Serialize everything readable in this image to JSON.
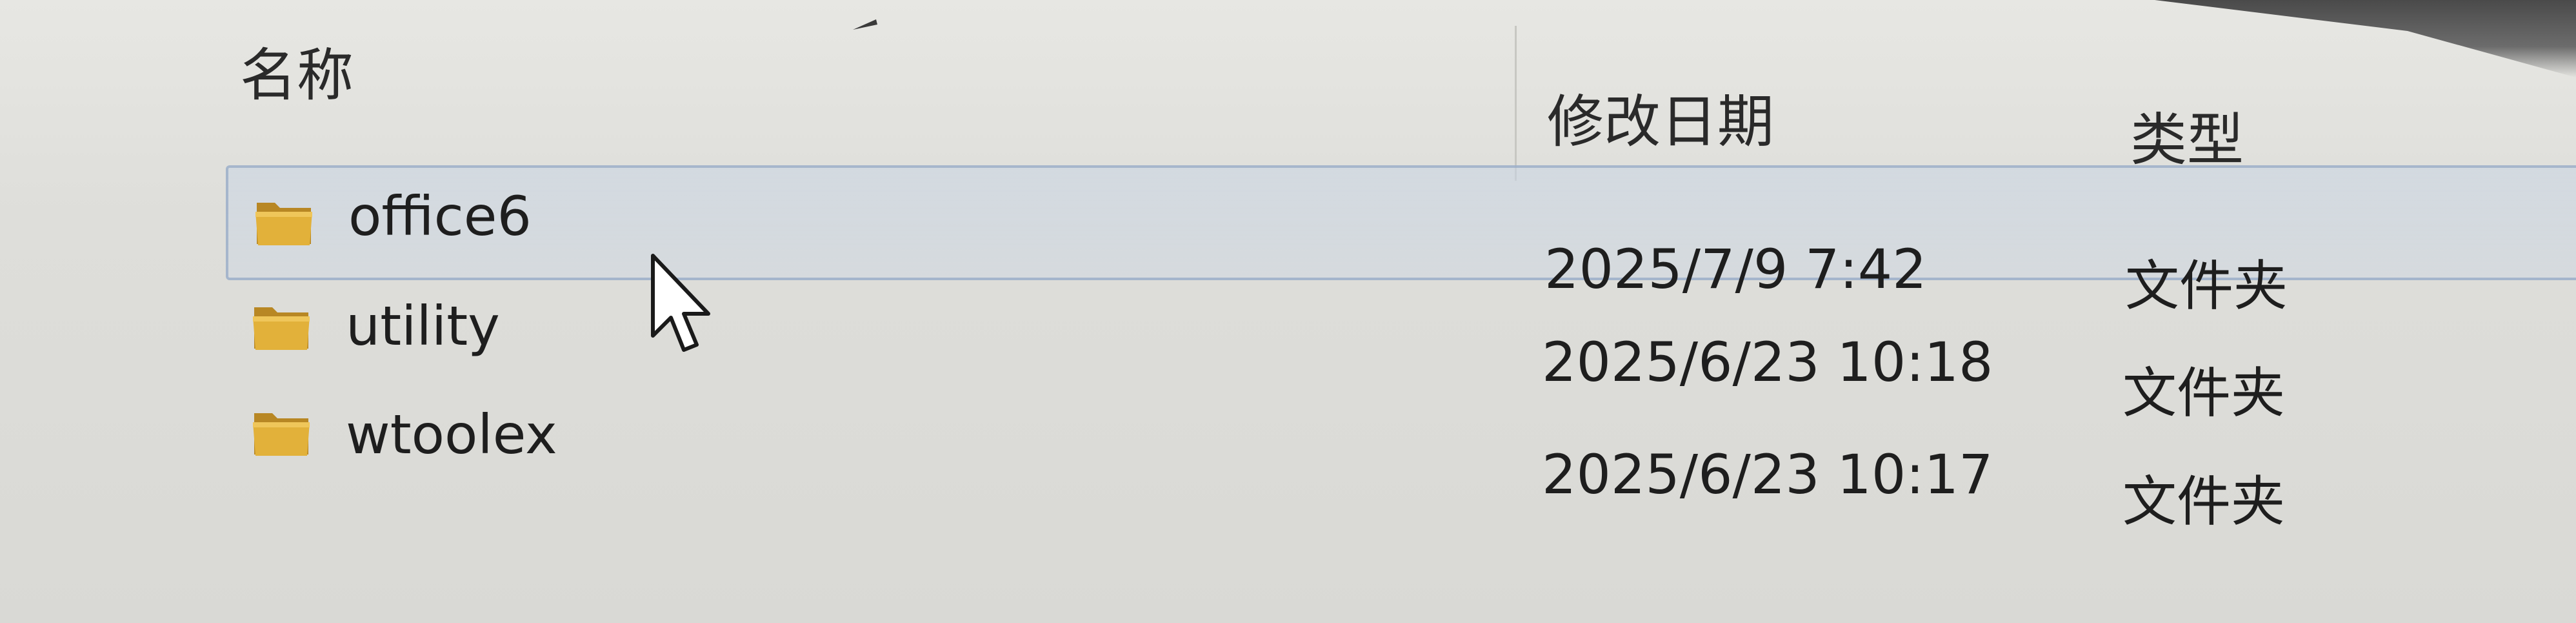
{
  "columns": {
    "name": "名称",
    "date_modified": "修改日期",
    "type": "类型"
  },
  "sort": {
    "column": "name",
    "icon": "sort-up-icon"
  },
  "files": [
    {
      "name": "office6",
      "date_modified": "2025/7/9 7:42",
      "type": "文件夹",
      "icon": "folder-icon",
      "selected": true
    },
    {
      "name": "utility",
      "date_modified": "2025/6/23 10:18",
      "type": "文件夹",
      "icon": "folder-icon",
      "selected": false
    },
    {
      "name": "wtoolex",
      "date_modified": "2025/6/23 10:17",
      "type": "文件夹",
      "icon": "folder-icon",
      "selected": false
    }
  ],
  "colors": {
    "folder": "#e2b13a",
    "folder_dark": "#b88724",
    "selection_fill": "#cdd7e4",
    "selection_border": "#96aac6"
  },
  "cursor": {
    "icon": "mouse-pointer-icon"
  }
}
